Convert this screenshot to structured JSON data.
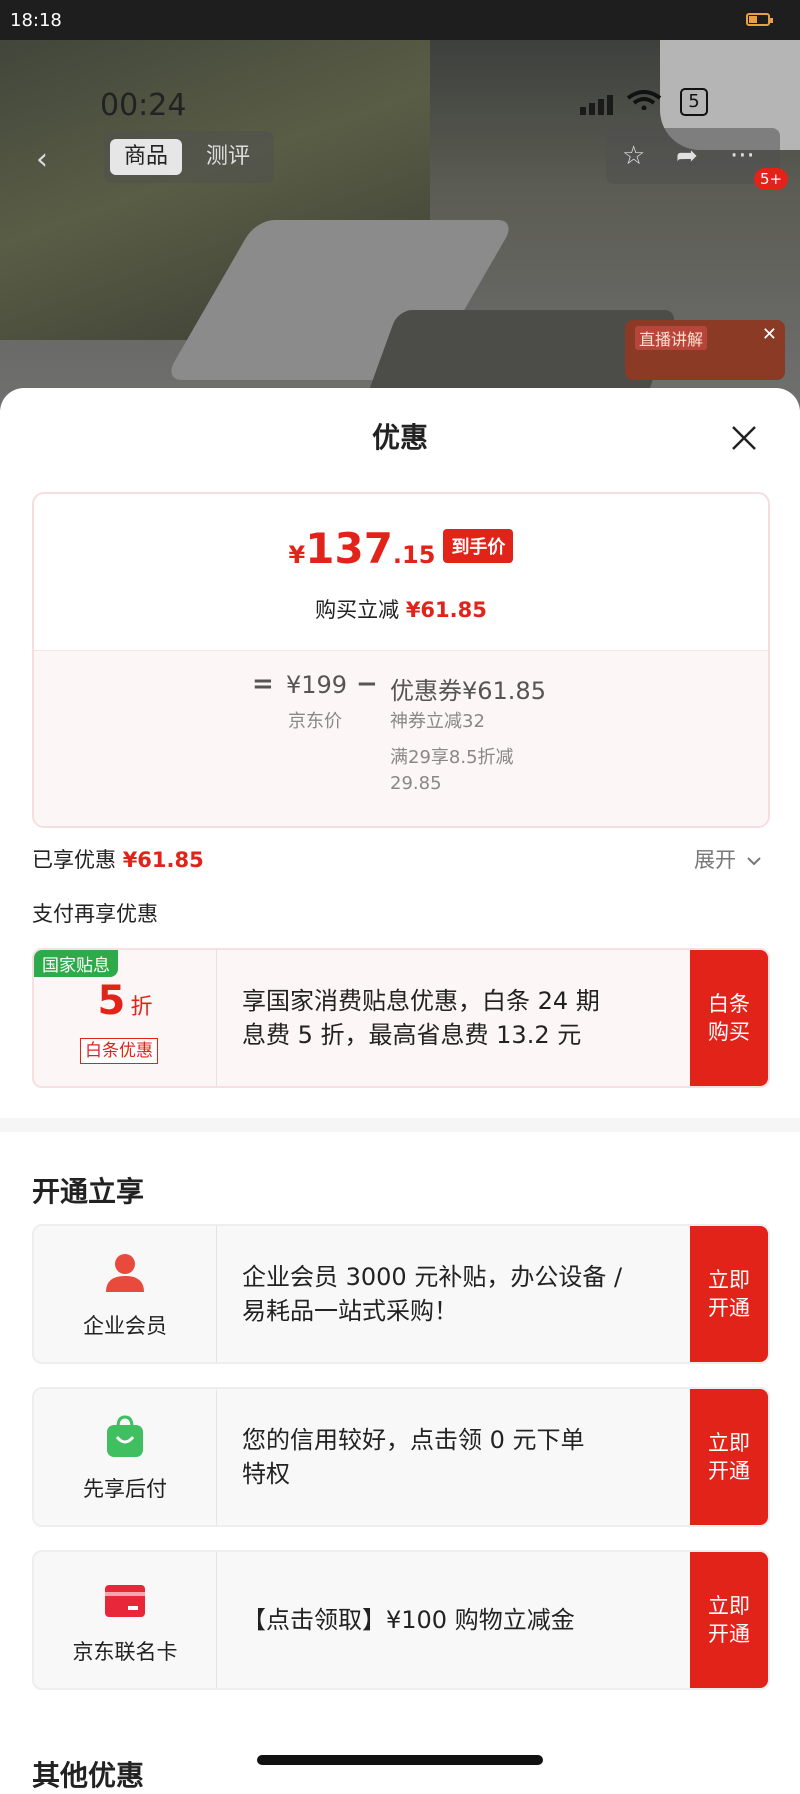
{
  "status_bar": {
    "time": "18:18"
  },
  "background": {
    "video_time": "00:24",
    "battery_badge": "5",
    "tabs": [
      "商品",
      "测评"
    ],
    "notification_count": "5+",
    "live_label": "直播讲解"
  },
  "sheet": {
    "title": "优惠",
    "summary": {
      "currency": "¥",
      "price_int": "137",
      "price_dec": ".15",
      "price_tag": "到手价",
      "reduce_label": "购买立减",
      "reduce_value": "¥61.85",
      "equals": "=",
      "base_price": "¥199",
      "base_label": "京东价",
      "minus": "−",
      "coupon": "优惠券¥61.85",
      "coupon_detail_1": "神券立减32",
      "coupon_detail_2a": "满29享8.5折减",
      "coupon_detail_2b": "29.85"
    },
    "enjoyed_label": "已享优惠",
    "enjoyed_value": "¥61.85",
    "expand_label": "展开",
    "pay_title": "支付再享优惠",
    "gov": {
      "badge": "国家贴息",
      "number": "5",
      "unit": "折",
      "tag": "白条优惠",
      "desc_1": "享国家消费贴息优惠，白条 24 期",
      "desc_2": "息费 5 折，最高省息费 13.2 元",
      "button": "白条购买"
    },
    "section_title": "开通立享",
    "cards": [
      {
        "icon": "person-icon",
        "label": "企业会员",
        "desc_1": "企业会员 3000 元补贴，办公设备 /",
        "desc_2": "易耗品一站式采购！",
        "button": "立即开通"
      },
      {
        "icon": "shopping-bag-icon",
        "label": "先享后付",
        "desc_1": "您的信用较好，点击领 0 元下单",
        "desc_2": "特权",
        "button": "立即开通"
      },
      {
        "icon": "credit-card-icon",
        "label": "京东联名卡",
        "desc_1": "【点击领取】¥100 购物立减金",
        "desc_2": "",
        "button": "立即开通"
      }
    ],
    "other_title": "其他优惠"
  },
  "colors": {
    "accent": "#e2231a",
    "green": "#2daa4a"
  }
}
